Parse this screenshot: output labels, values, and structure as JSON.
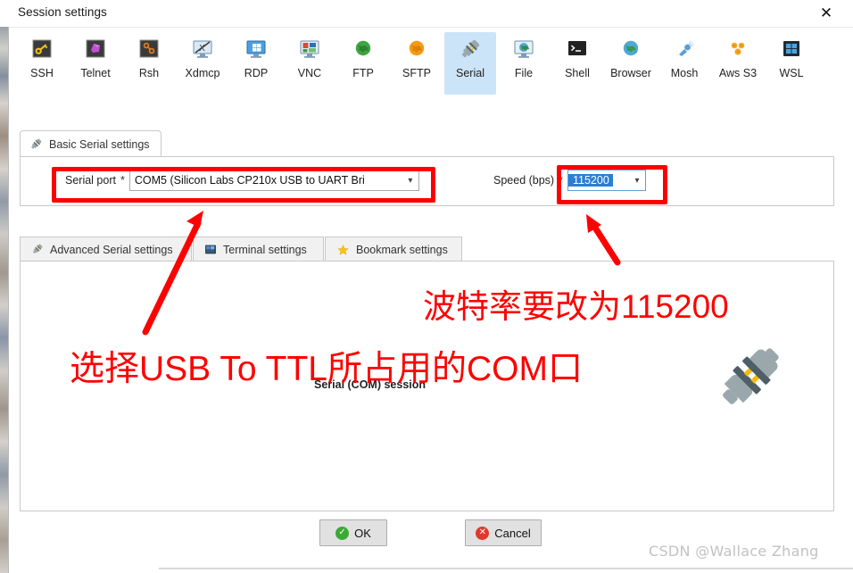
{
  "window": {
    "title": "Session settings",
    "close_icon": "close-icon"
  },
  "session_types": [
    {
      "label": "SSH",
      "icon": "ssh-icon",
      "selected": false
    },
    {
      "label": "Telnet",
      "icon": "telnet-icon",
      "selected": false
    },
    {
      "label": "Rsh",
      "icon": "rsh-icon",
      "selected": false
    },
    {
      "label": "Xdmcp",
      "icon": "xdmcp-icon",
      "selected": false
    },
    {
      "label": "RDP",
      "icon": "rdp-icon",
      "selected": false
    },
    {
      "label": "VNC",
      "icon": "vnc-icon",
      "selected": false
    },
    {
      "label": "FTP",
      "icon": "ftp-icon",
      "selected": false
    },
    {
      "label": "SFTP",
      "icon": "sftp-icon",
      "selected": false
    },
    {
      "label": "Serial",
      "icon": "serial-icon",
      "selected": true
    },
    {
      "label": "File",
      "icon": "file-icon",
      "selected": false
    },
    {
      "label": "Shell",
      "icon": "shell-icon",
      "selected": false
    },
    {
      "label": "Browser",
      "icon": "browser-icon",
      "selected": false
    },
    {
      "label": "Mosh",
      "icon": "mosh-icon",
      "selected": false
    },
    {
      "label": "Aws S3",
      "icon": "aws-s3-icon",
      "selected": false
    },
    {
      "label": "WSL",
      "icon": "wsl-icon",
      "selected": false
    }
  ],
  "basic_tab": {
    "label": "Basic Serial settings",
    "icon": "serial-plug-icon",
    "serial_port": {
      "label": "Serial port",
      "required_mark": "*",
      "value": "COM5  (Silicon Labs CP210x USB to UART Bri",
      "arrow": "chevron-down-icon"
    },
    "speed": {
      "label": "Speed (bps)",
      "required_mark": "*",
      "value": "115200",
      "arrow": "chevron-down-icon"
    }
  },
  "sub_tabs": [
    {
      "label": "Advanced Serial settings",
      "icon": "serial-plug-icon"
    },
    {
      "label": "Terminal settings",
      "icon": "terminal-icon"
    },
    {
      "label": "Bookmark settings",
      "icon": "star-icon"
    }
  ],
  "panel": {
    "session_caption": "Serial (COM) session",
    "big_icon": "serial-plug-large-icon"
  },
  "buttons": {
    "ok": {
      "label": "OK",
      "icon": "check-circle-icon"
    },
    "cancel": {
      "label": "Cancel",
      "icon": "cross-circle-icon"
    }
  },
  "watermark": "CSDN @Wallace Zhang",
  "annotations": {
    "speed_note": "波特率要改为115200",
    "port_note": "选择USB To TTL所占用的COM口",
    "highlight_color": "#fe0000"
  }
}
